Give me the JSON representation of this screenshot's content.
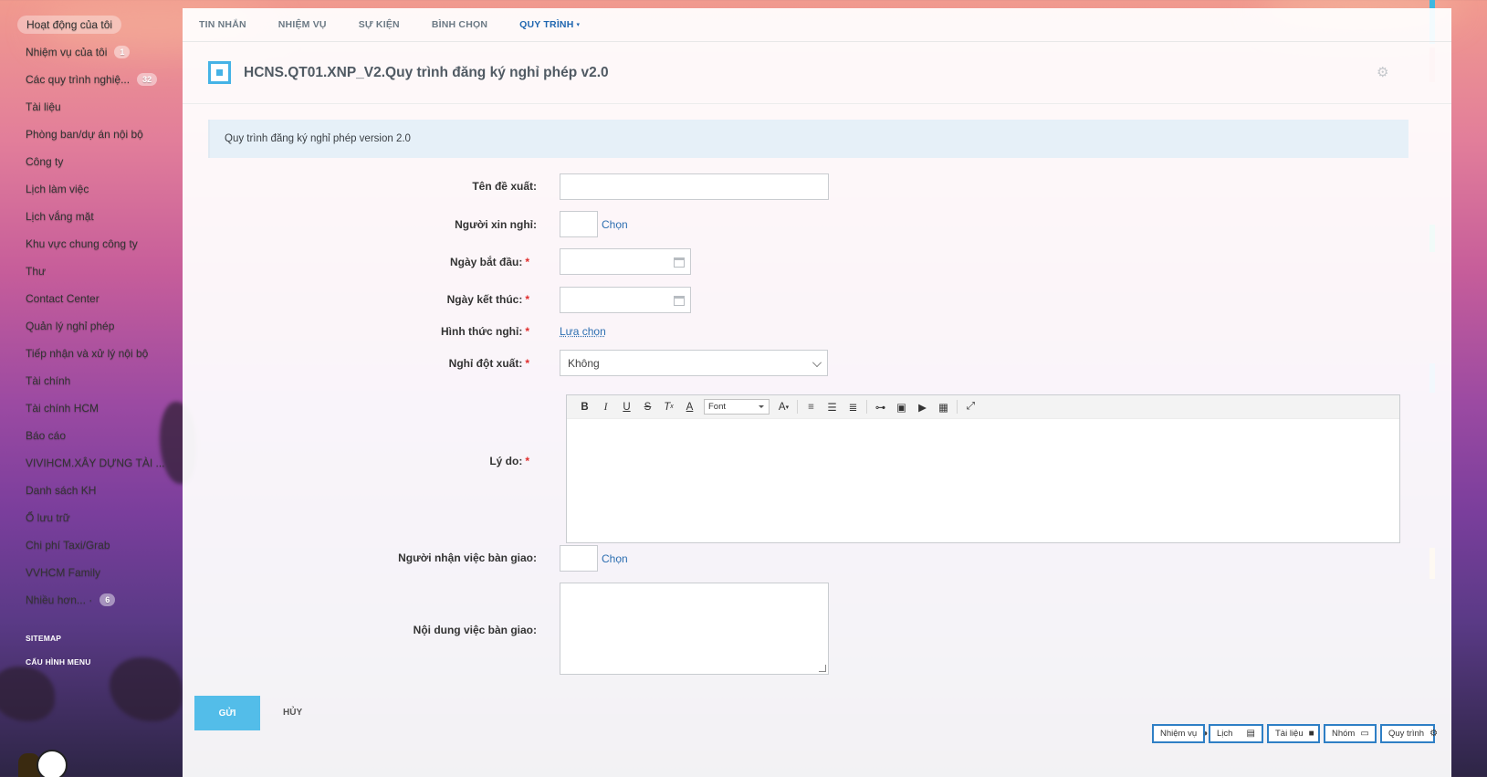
{
  "sidebar": {
    "items": [
      {
        "label": "Hoạt động của tôi",
        "badge": ""
      },
      {
        "label": "Nhiệm vụ của tôi",
        "badge": "1"
      },
      {
        "label": "Các quy trình nghiệ...",
        "badge": "32"
      },
      {
        "label": "Tài liệu",
        "badge": ""
      },
      {
        "label": "Phòng ban/dự án nội bộ",
        "badge": ""
      },
      {
        "label": "Công ty",
        "badge": ""
      },
      {
        "label": "Lịch làm việc",
        "badge": ""
      },
      {
        "label": "Lịch vắng mặt",
        "badge": ""
      },
      {
        "label": "Khu vực chung công ty",
        "badge": ""
      },
      {
        "label": "Thư",
        "badge": ""
      },
      {
        "label": "Contact Center",
        "badge": ""
      },
      {
        "label": "Quản lý nghỉ phép",
        "badge": ""
      },
      {
        "label": "Tiếp nhận và xử lý nội bộ",
        "badge": ""
      },
      {
        "label": "Tài chính",
        "badge": ""
      },
      {
        "label": "Tài chính HCM",
        "badge": ""
      },
      {
        "label": "Báo cáo",
        "badge": ""
      },
      {
        "label": "VIVIHCM.XÂY DỰNG TÀI ...",
        "badge": ""
      },
      {
        "label": "Danh sách KH",
        "badge": ""
      },
      {
        "label": "Ổ lưu trữ",
        "badge": ""
      },
      {
        "label": "Chi phí Taxi/Grab",
        "badge": ""
      },
      {
        "label": "VVHCM Family",
        "badge": ""
      },
      {
        "label": "Nhiều hơn... ·",
        "badge": "6"
      }
    ],
    "sitemap": "SITEMAP",
    "menu_config": "CẤU HÌNH MENU"
  },
  "topnav": {
    "tabs": [
      "TIN NHẮN",
      "NHIỆM VỤ",
      "SỰ KIỆN",
      "BÌNH CHỌN",
      "QUY TRÌNH"
    ],
    "caret": "▾"
  },
  "header": {
    "title": "HCNS.QT01.XNP_V2.Quy trình đăng ký nghỉ phép v2.0"
  },
  "description": "Quy trình đăng ký nghỉ phép version 2.0",
  "form": {
    "ten_de_xuat": "Tên đề xuất:",
    "nguoi_xin_nghi": "Người xin nghỉ:",
    "ngay_bat_dau": "Ngày bắt đầu:",
    "ngay_ket_thuc": "Ngày kết thúc:",
    "hinh_thuc_nghi": "Hình thức nghỉ:",
    "nghi_dot_xuat": "Nghỉ đột xuất:",
    "ly_do": "Lý do:",
    "nguoi_nhan_viec": "Người nhận việc bàn giao:",
    "noi_dung_viec": "Nội dung việc bàn giao:",
    "required_mark": "*",
    "chon": "Chọn",
    "lua_chon": "Lựa chọn",
    "nghi_dot_xuat_value": "Không",
    "font_label": "Font"
  },
  "buttons": {
    "send": "GỬI",
    "cancel": "HỦY"
  },
  "taskbar": [
    "Nhiệm vụ",
    "Lịch",
    "Tài liệu",
    "Nhóm",
    "Quy trình"
  ]
}
